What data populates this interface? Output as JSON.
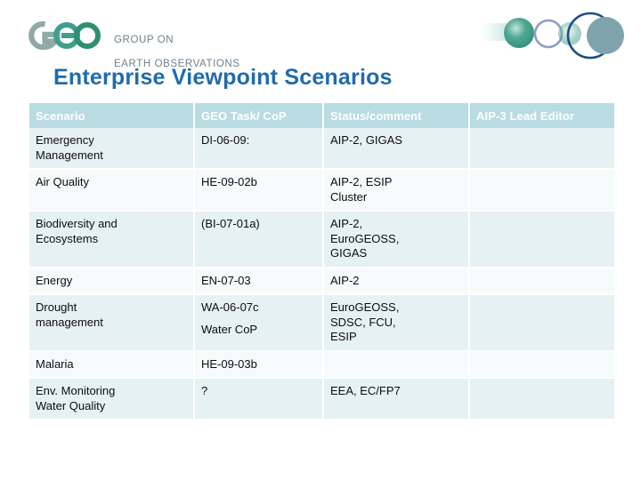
{
  "logo": {
    "mark_alt": "GEO",
    "line1": "GROUP ON",
    "line2": "EARTH OBSERVATIONS",
    "wordmark_color": "#2e8f72",
    "text_color": "#6f7f8c"
  },
  "decoration": {
    "circle_filled_teal": "#3f9e8e",
    "circle_ring_blue_gray": "#8e9dc4",
    "circle_ring_navy": "#1b4f83",
    "circle_filled_gray_teal": "#7fa3ad"
  },
  "title": {
    "text": "Enterprise Viewpoint Scenarios",
    "color": "#1F6BAD"
  },
  "table": {
    "header_bg": "#b9dce3",
    "row_shade_bg": "#e6f1f3",
    "row_plain_bg": "#f6fafb",
    "headers": [
      "Scenario",
      "GEO Task/ CoP",
      "Status/comment",
      "AIP-3 Lead Editor"
    ],
    "rows": [
      {
        "shade": true,
        "scenario": [
          "Emergency",
          "Management"
        ],
        "task": [
          "DI-06-09:"
        ],
        "status": [
          "AIP-2, GIGAS"
        ],
        "editor": []
      },
      {
        "shade": false,
        "scenario": [
          "Air Quality"
        ],
        "task": [
          "HE-09-02b"
        ],
        "status": [
          "AIP-2, ESIP",
          "Cluster"
        ],
        "editor": []
      },
      {
        "shade": true,
        "scenario": [
          "Biodiversity and",
          "Ecosystems"
        ],
        "task": [
          "(BI-07-01a)"
        ],
        "status": [
          "AIP-2,",
          "EuroGEOSS,",
          "GIGAS"
        ],
        "editor": []
      },
      {
        "shade": false,
        "scenario": [
          "Energy"
        ],
        "task": [
          "EN-07-03"
        ],
        "status": [
          "AIP-2"
        ],
        "editor": []
      },
      {
        "shade": true,
        "scenario": [
          "Drought",
          "management"
        ],
        "task": [
          "WA-06-07c",
          "",
          "Water CoP"
        ],
        "status": [
          "EuroGEOSS,",
          "SDSC, FCU,",
          "ESIP"
        ],
        "editor": []
      },
      {
        "shade": false,
        "scenario": [
          "Malaria"
        ],
        "task": [
          "HE-09-03b"
        ],
        "status": [],
        "editor": []
      },
      {
        "shade": true,
        "scenario": [
          "Env. Monitoring",
          "Water Quality"
        ],
        "task": [
          "?"
        ],
        "status": [
          "EEA, EC/FP7"
        ],
        "editor": []
      }
    ]
  }
}
